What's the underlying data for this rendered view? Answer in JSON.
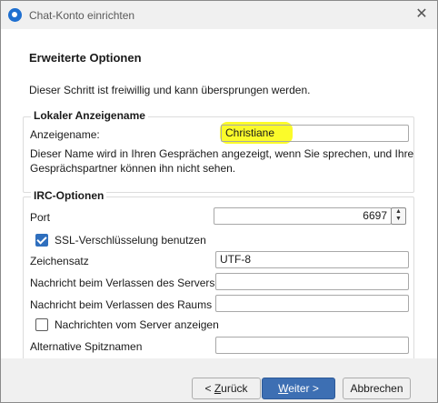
{
  "window": {
    "title": "Chat-Konto einrichten",
    "close_glyph": "✕"
  },
  "page": {
    "title": "Erweiterte Optionen",
    "description": "Dieser Schritt ist freiwillig und kann übersprungen werden."
  },
  "local_group": {
    "title": "Lokaler Anzeigename",
    "display_name_label": "Anzeigename:",
    "display_name_value": "Christiane",
    "help_line1": "Dieser Name wird in Ihren Gesprächen angezeigt, wenn Sie sprechen, und Ihre",
    "help_line2": "Gesprächspartner können ihn nicht sehen."
  },
  "irc_group": {
    "title": "IRC-Optionen",
    "port_label": "Port",
    "port_value": "6697",
    "ssl_label": "SSL-Verschlüsselung benutzen",
    "ssl_checked": true,
    "charset_label": "Zeichensatz",
    "charset_value": "UTF-8",
    "quit_msg_label": "Nachricht beim Verlassen des Servers",
    "quit_msg_value": "",
    "part_msg_label": "Nachricht beim Verlassen des Raums",
    "part_msg_value": "",
    "show_server_label": "Nachrichten vom Server anzeigen",
    "show_server_checked": false,
    "alt_nicks_label": "Alternative Spitznamen",
    "alt_nicks_value": ""
  },
  "footer": {
    "back_prefix": "< ",
    "back_mnemonic": "Z",
    "back_rest": "urück",
    "next_mnemonic": "W",
    "next_rest": "eiter >",
    "cancel": "Abbrechen"
  },
  "colors": {
    "accent": "#3d6fb3",
    "highlight": "#fbfb2a",
    "checkbox": "#2f6fbe"
  },
  "icons": {
    "app": "chat-app-icon",
    "close": "close-icon",
    "spinner": "spinner-arrows-icon"
  }
}
